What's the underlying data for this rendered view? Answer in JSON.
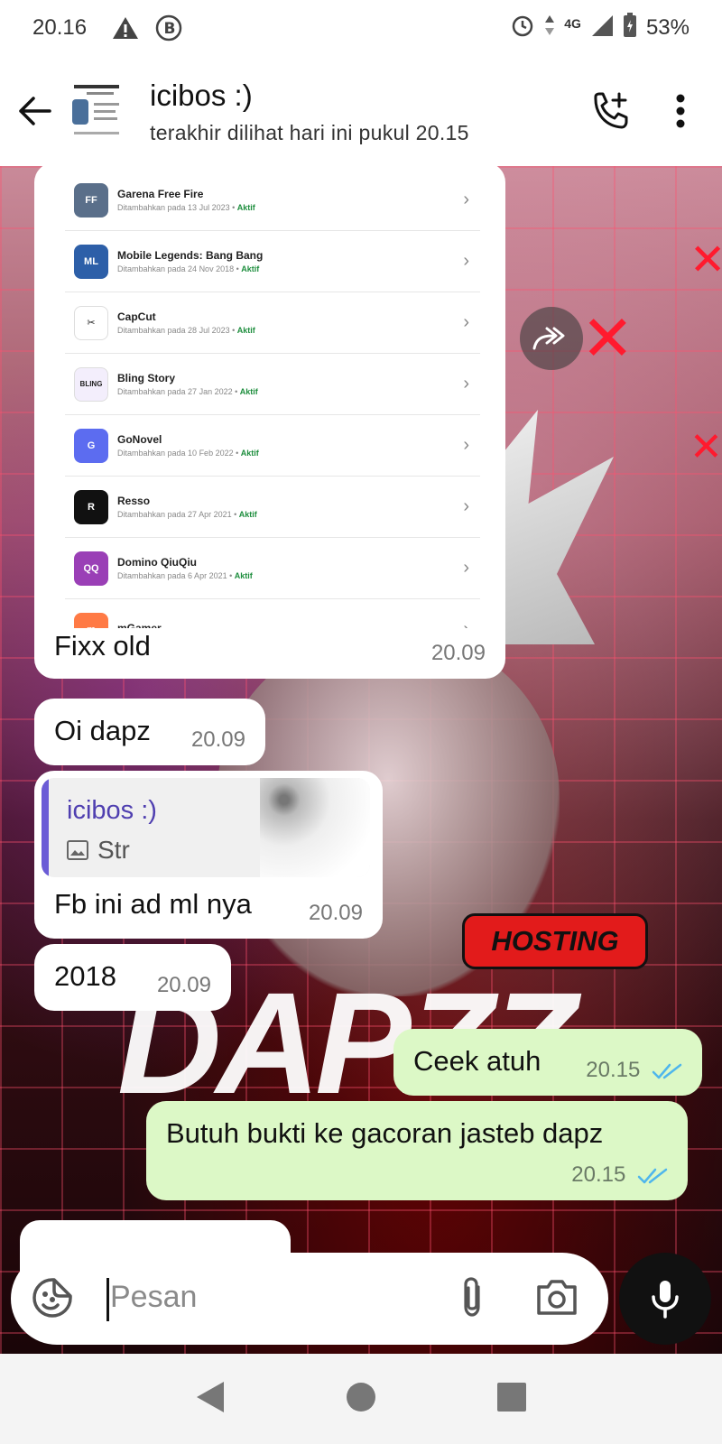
{
  "status_bar": {
    "time": "20.16",
    "network": "4G",
    "battery": "53%"
  },
  "header": {
    "contact_name": "icibos :)",
    "last_seen": "terakhir dilihat hari ini pukul 20.15"
  },
  "background": {
    "hosting_label": "HOSTING",
    "big_text": "DAPZZ"
  },
  "app_list": [
    {
      "name": "Garena Free Fire",
      "meta": "Ditambahkan pada 13 Jul 2023",
      "status": "Aktif",
      "color": "#5a6f8a",
      "glyph": "FF"
    },
    {
      "name": "Mobile Legends: Bang Bang",
      "meta": "Ditambahkan pada 24 Nov 2018",
      "status": "Aktif",
      "color": "#2d5fa8",
      "glyph": "ML"
    },
    {
      "name": "CapCut",
      "meta": "Ditambahkan pada 28 Jul 2023",
      "status": "Aktif",
      "color": "#ffffff",
      "glyph": "✂"
    },
    {
      "name": "Bling Story",
      "meta": "Ditambahkan pada 27 Jan 2022",
      "status": "Aktif",
      "color": "#f3eefc",
      "glyph": "BLING"
    },
    {
      "name": "GoNovel",
      "meta": "Ditambahkan pada 10 Feb 2022",
      "status": "Aktif",
      "color": "#5c6cf0",
      "glyph": "G"
    },
    {
      "name": "Resso",
      "meta": "Ditambahkan pada 27 Apr 2021",
      "status": "Aktif",
      "color": "#111111",
      "glyph": "R"
    },
    {
      "name": "Domino QiuQiu",
      "meta": "Ditambahkan pada 6 Apr 2021",
      "status": "Aktif",
      "color": "#9a3fb6",
      "glyph": "QQ"
    },
    {
      "name": "mGamer",
      "meta": "",
      "status": "",
      "color": "#ff7a45",
      "glyph": "m"
    }
  ],
  "messages": {
    "m1": {
      "text": "Fixx old",
      "time": "20.09"
    },
    "m2": {
      "text": "Oi dapz",
      "time": "20.09"
    },
    "m3": {
      "quote_name": "icibos :)",
      "quote_text": "Str",
      "text": "Fb ini ad ml nya",
      "time": "20.09"
    },
    "m4": {
      "text": "2018",
      "time": "20.09"
    },
    "m5": {
      "text": "Ceek atuh",
      "time": "20.15"
    },
    "m6": {
      "text": "Butuh bukti ke gacoran jasteb dapz",
      "time": "20.15"
    }
  },
  "input": {
    "placeholder": "Pesan"
  },
  "colors": {
    "outgoing_bubble": "#dcf8c6",
    "tick_blue": "#4fb6ec",
    "quote_accent": "#6b5cd6"
  }
}
